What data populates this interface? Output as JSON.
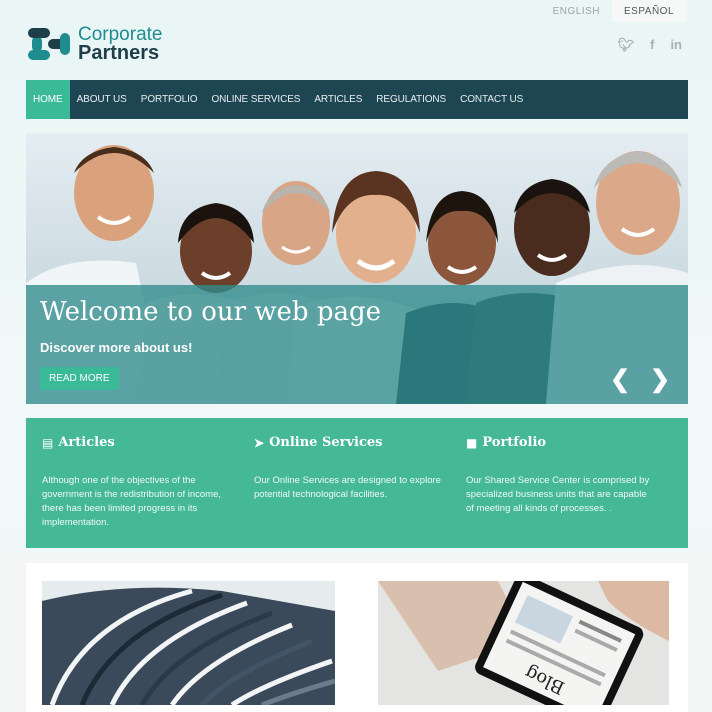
{
  "languages": [
    {
      "label": "ENGLISH",
      "active": false
    },
    {
      "label": "ESPAÑOL",
      "active": true
    }
  ],
  "logo": {
    "line1": "Corporate",
    "line2": "Partners"
  },
  "social": [
    "twitter-icon",
    "facebook-icon",
    "linkedin-icon"
  ],
  "nav": [
    {
      "label": "HOME",
      "active": true
    },
    {
      "label": "ABOUT US"
    },
    {
      "label": "PORTFOLIO"
    },
    {
      "label": "ONLINE SERVICES"
    },
    {
      "label": "ARTICLES"
    },
    {
      "label": "REGULATIONS"
    },
    {
      "label": "CONTACT US"
    }
  ],
  "hero": {
    "title": "Welcome to our web page",
    "subtitle": "Discover more about us!",
    "button": "READ MORE",
    "prev": "❮",
    "next": "❯"
  },
  "features": [
    {
      "icon": "newspaper-icon",
      "title": "Articles",
      "text": "Although one of the objectives of the government is the redistribution of income, there has been limited progress in its implementation."
    },
    {
      "icon": "cursor-icon",
      "title": "Online Services",
      "text": "Our Online Services are designed to explore potential technological facilities."
    },
    {
      "icon": "briefcase-icon",
      "title": "Portfolio",
      "text": "Our Shared Service Center is comprised by specialized business units that are capable of meeting all kinds of processes. ."
    }
  ],
  "colors": {
    "nav": "#1e4652",
    "accent": "#3bba98",
    "brand": "#1f8c8f"
  }
}
